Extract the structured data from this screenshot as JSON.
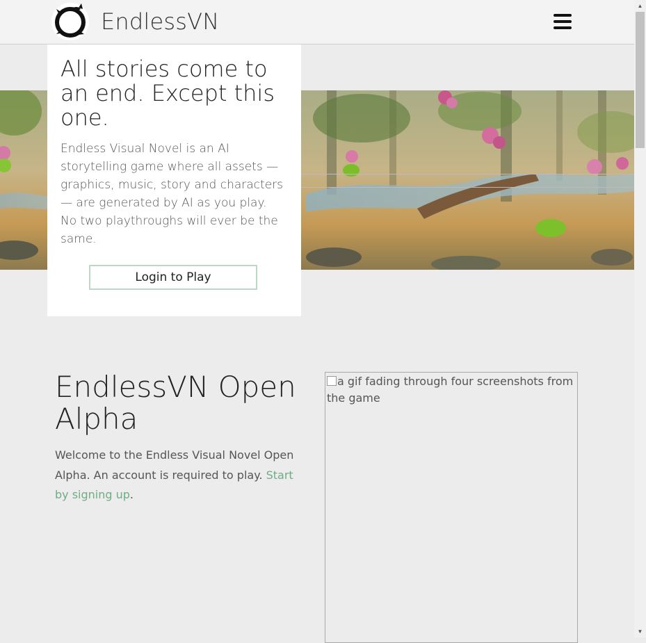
{
  "header": {
    "brand": "EndlessVN",
    "logo_icon": "ouroboros-dragon-logo",
    "menu_icon": "hamburger-menu-icon"
  },
  "hero": {
    "title": "All stories come to an end. Except this one.",
    "description_line1": "Endless Visual Novel is an AI storytelling game where all assets — graphics, music, story and characters — are generated by AI as you play.",
    "description_line2": "No two playthroughs will ever be the same.",
    "login_label": "Login to Play"
  },
  "alpha": {
    "title": "EndlessVN Open Alpha",
    "text_before": "Welcome to the Endless Visual Novel Open Alpha. An account is required to play. ",
    "signup_link": "Start by signing up",
    "text_after": ".",
    "gif_alt": "a gif fading through four screenshots from the game"
  },
  "colors": {
    "accent_green": "#6fad84",
    "button_border": "#bcd9c5",
    "page_bg": "#ececec"
  }
}
